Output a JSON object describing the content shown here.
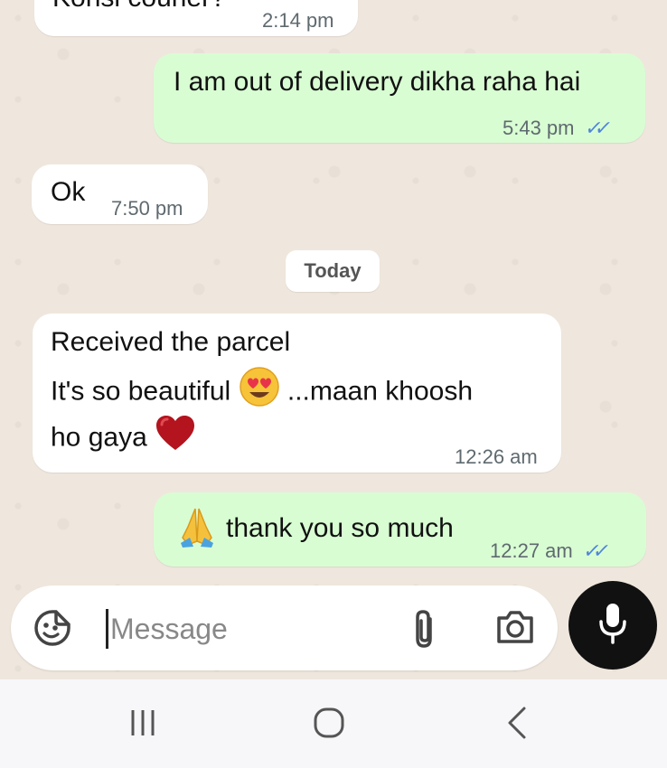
{
  "messages": [
    {
      "direction": "in",
      "text": "Konsi courier?",
      "time": "2:14 pm"
    },
    {
      "direction": "out",
      "text": "I am out of delivery dikha raha hai",
      "time": "5:43 pm",
      "read": true
    },
    {
      "direction": "in",
      "text": "Ok",
      "time": "7:50 pm"
    },
    {
      "direction": "in",
      "line1": "Received the parcel",
      "line2_a": "It's so beautiful",
      "line2_b": "...maan khoosh",
      "line3": "ho gaya",
      "time": "12:26 am"
    },
    {
      "direction": "out",
      "text": "thank you so much",
      "time": "12:27 am",
      "read": true
    }
  ],
  "date_separator": "Today",
  "composer": {
    "placeholder": "Message"
  },
  "icons": {
    "sticker": "sticker-icon",
    "attach": "paperclip-icon",
    "camera": "camera-icon",
    "mic": "microphone-icon",
    "read": "double-check-icon",
    "heart_eyes": "heart-eyes-emoji",
    "heart": "red-heart-emoji",
    "pray": "folded-hands-emoji"
  },
  "colors": {
    "outgoing_bubble": "#d9fdd3",
    "incoming_bubble": "#ffffff",
    "read_ticks": "#4f86d9",
    "chat_background": "#efe7dd"
  }
}
